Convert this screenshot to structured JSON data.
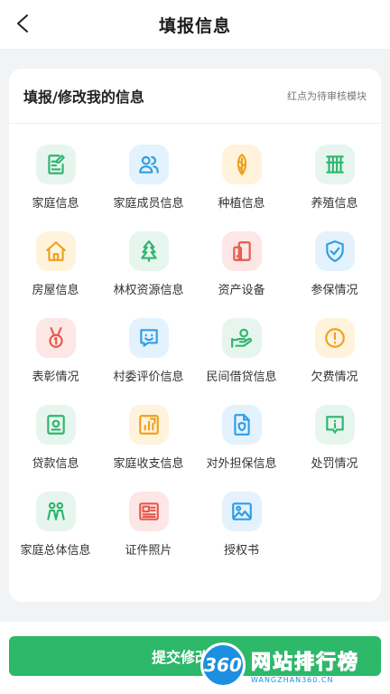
{
  "header": {
    "title": "填报信息"
  },
  "panel": {
    "title": "填报/修改我的信息",
    "hint": "红点为待审核模块"
  },
  "items": [
    {
      "label": "家庭信息",
      "icon": "form-edit-icon"
    },
    {
      "label": "家庭成员信息",
      "icon": "users-icon"
    },
    {
      "label": "种植信息",
      "icon": "seed-icon"
    },
    {
      "label": "养殖信息",
      "icon": "fence-icon"
    },
    {
      "label": "房屋信息",
      "icon": "house-icon"
    },
    {
      "label": "林权资源信息",
      "icon": "tree-icon"
    },
    {
      "label": "资产设备",
      "icon": "devices-icon"
    },
    {
      "label": "参保情况",
      "icon": "shield-check-icon"
    },
    {
      "label": "表彰情况",
      "icon": "medal-icon"
    },
    {
      "label": "村委评价信息",
      "icon": "chat-smile-icon"
    },
    {
      "label": "民间借贷信息",
      "icon": "hand-coin-icon"
    },
    {
      "label": "欠费情况",
      "icon": "alert-circle-icon"
    },
    {
      "label": "贷款信息",
      "icon": "safe-icon"
    },
    {
      "label": "家庭收支信息",
      "icon": "bar-chart-icon"
    },
    {
      "label": "对外担保信息",
      "icon": "doc-shield-icon"
    },
    {
      "label": "处罚情况",
      "icon": "info-chat-icon"
    },
    {
      "label": "家庭总体信息",
      "icon": "family-icon"
    },
    {
      "label": "证件照片",
      "icon": "id-card-icon"
    },
    {
      "label": "授权书",
      "icon": "image-icon"
    }
  ],
  "submit": {
    "label": "提交修改信息"
  },
  "watermark": {
    "badge": "360",
    "main": "网站排行榜",
    "sub": "WANGZHAN360.CN"
  },
  "colors": {
    "green": "#2fb56f",
    "blue": "#2f9ee6",
    "orange": "#f0a020",
    "red": "#e55b4c",
    "button": "#2db86a"
  }
}
